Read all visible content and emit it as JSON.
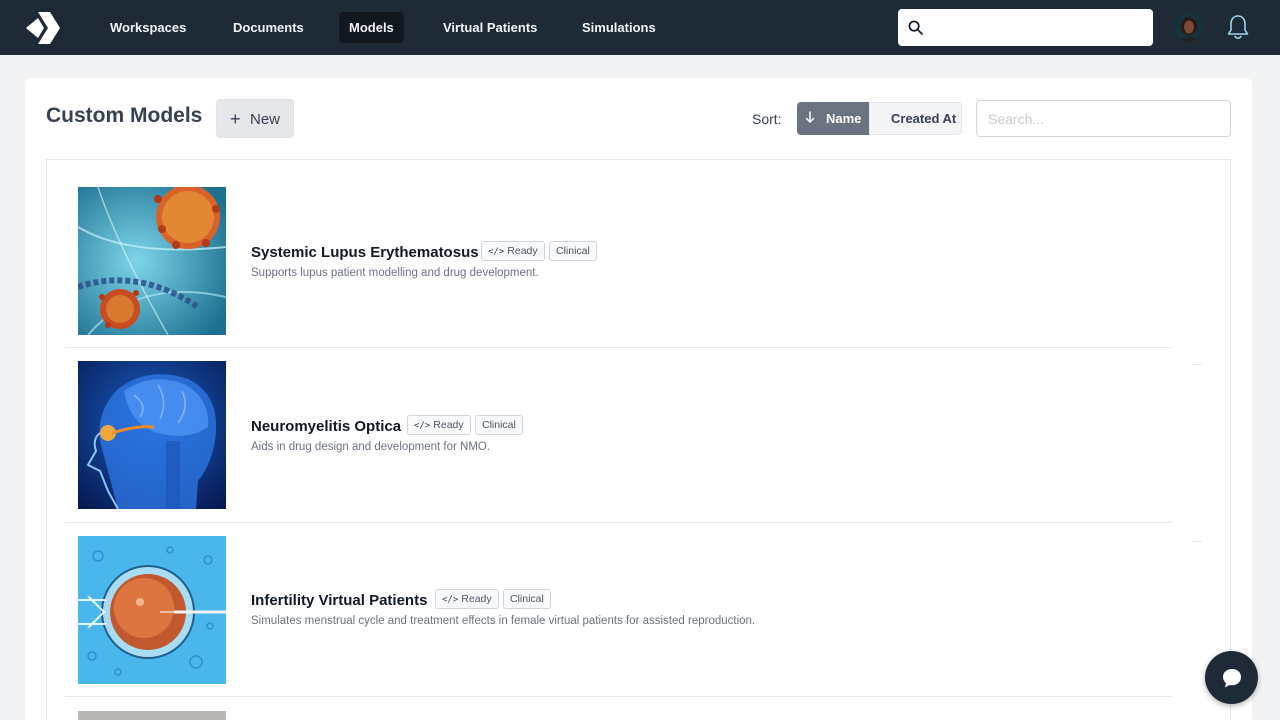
{
  "nav": {
    "items": [
      {
        "label": "Workspaces",
        "active": false
      },
      {
        "label": "Documents",
        "active": false
      },
      {
        "label": "Models",
        "active": true
      },
      {
        "label": "Virtual Patients",
        "active": false
      },
      {
        "label": "Simulations",
        "active": false
      }
    ],
    "search": {
      "value": "",
      "placeholder": ""
    },
    "icons": [
      "logo-icon",
      "search-icon",
      "avatar",
      "bell-icon"
    ]
  },
  "page": {
    "title": "Custom Models",
    "new_label": "New",
    "sort_label": "Sort:",
    "sort_options": [
      {
        "label": "Name",
        "active": true,
        "direction": "desc"
      },
      {
        "label": "Created At",
        "active": false
      }
    ],
    "search_placeholder": "Search..."
  },
  "models": [
    {
      "title": "Systemic Lupus Erythematosus",
      "status": "Ready",
      "tag": "Clinical",
      "description": "Supports lupus patient modelling and drug development.",
      "image": "virus-cells-image"
    },
    {
      "title": "Neuromyelitis Optica",
      "status": "Ready",
      "tag": "Clinical",
      "description": "Aids in drug design and development for NMO.",
      "image": "brain-optic-nerve-image"
    },
    {
      "title": "Infertility Virtual Patients",
      "status": "Ready",
      "tag": "Clinical",
      "description": "Simulates menstrual cycle and treatment effects in female virtual patients for assisted reproduction.",
      "image": "egg-cell-injection-image"
    }
  ],
  "colors": {
    "nav_bg": "#1f2a37",
    "nav_active": "#111820",
    "sort_active": "#6b7280",
    "page_bg": "#f1f3f4"
  }
}
